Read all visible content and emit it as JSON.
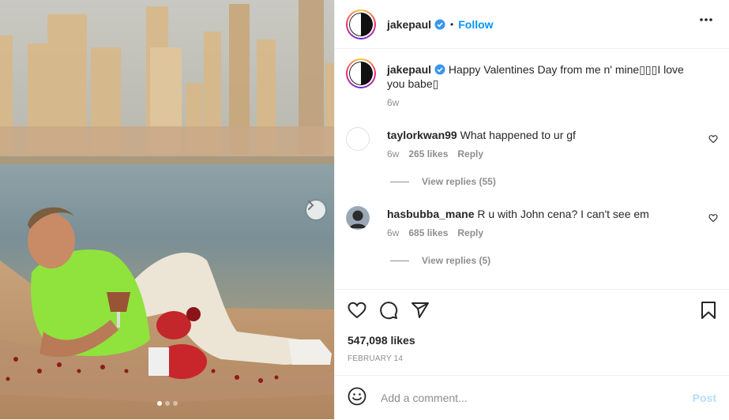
{
  "author": {
    "username": "jakepaul",
    "verified": true,
    "separator": "•",
    "follow_label": "Follow"
  },
  "caption": {
    "username": "jakepaul",
    "text": "Happy Valentines Day from me n' mine▯▯▯I love you babe▯",
    "time": "6w"
  },
  "comments": [
    {
      "username": "taylorkwan99",
      "text": "What happened to ur gf",
      "time": "6w",
      "likes": "265 likes",
      "reply_label": "Reply",
      "view_replies": "View replies (55)"
    },
    {
      "username": "hasbubba_mane",
      "text": "R u with John cena? I can't see em",
      "time": "6w",
      "likes": "685 likes",
      "reply_label": "Reply",
      "view_replies": "View replies (5)"
    }
  ],
  "post": {
    "likes": "547,098 likes",
    "date": "FEBRUARY 14",
    "carousel": {
      "count": 3,
      "active_index": 0
    }
  },
  "add_comment": {
    "placeholder": "Add a comment...",
    "post_label": "Post"
  },
  "icons": {
    "heart": "heart-icon",
    "comment": "comment-icon",
    "share": "share-icon",
    "save": "bookmark-icon",
    "more": "more-options-icon",
    "emoji": "emoji-icon",
    "next": "chevron-right-icon"
  },
  "colors": {
    "accent": "#0095f6",
    "post_disabled": "#b2dffc",
    "muted": "#8e8e8e",
    "text": "#262626"
  }
}
